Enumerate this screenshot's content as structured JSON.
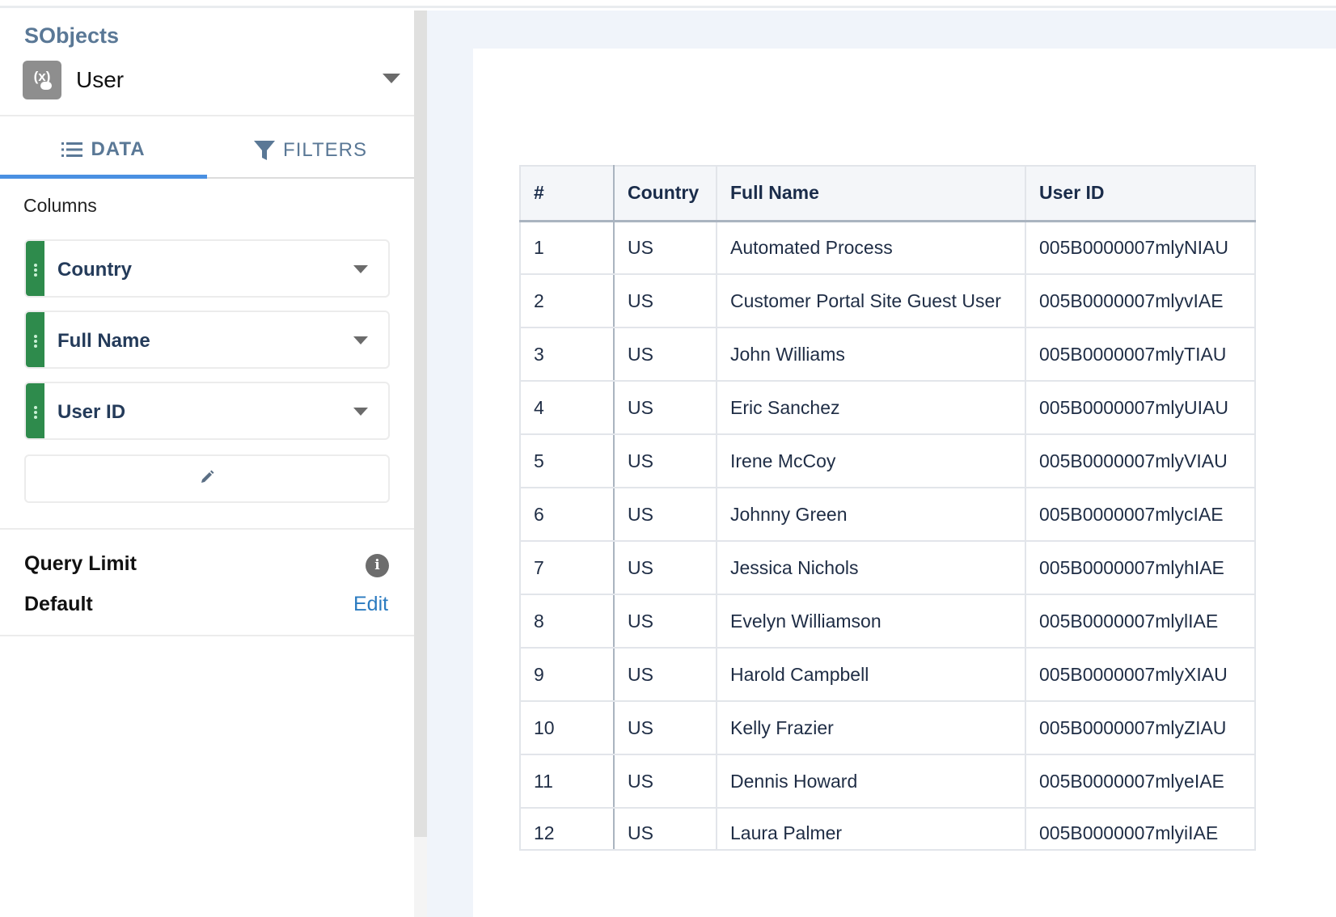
{
  "sidebar": {
    "section_title": "SObjects",
    "object": {
      "name": "User",
      "icon": "salesforce-variable-icon"
    },
    "tabs": [
      {
        "label": "DATA",
        "icon": "list-icon",
        "active": true
      },
      {
        "label": "FILTERS",
        "icon": "filter-icon",
        "active": false
      }
    ],
    "columns_label": "Columns",
    "columns": [
      {
        "label": "Country"
      },
      {
        "label": "Full Name"
      },
      {
        "label": "User ID"
      }
    ],
    "edit_columns_icon": "pencil-icon",
    "query_limit": {
      "label": "Query Limit",
      "value": "Default",
      "edit_label": "Edit",
      "info_icon": "info-icon"
    }
  },
  "colors": {
    "accent": "#4a90e2",
    "handle_green": "#2e8b4c",
    "link_blue": "#2b7bc0",
    "header_text": "#5a7896"
  },
  "table": {
    "headers": [
      "#",
      "Country",
      "Full Name",
      "User ID"
    ],
    "rows": [
      [
        "1",
        "US",
        "Automated Process",
        "005B0000007mlyNIAU"
      ],
      [
        "2",
        "US",
        "Customer Portal Site Guest User",
        "005B0000007mlyvIAE"
      ],
      [
        "3",
        "US",
        "John Williams",
        "005B0000007mlyTIAU"
      ],
      [
        "4",
        "US",
        "Eric Sanchez",
        "005B0000007mlyUIAU"
      ],
      [
        "5",
        "US",
        "Irene McCoy",
        "005B0000007mlyVIAU"
      ],
      [
        "6",
        "US",
        "Johnny Green",
        "005B0000007mlycIAE"
      ],
      [
        "7",
        "US",
        "Jessica Nichols",
        "005B0000007mlyhIAE"
      ],
      [
        "8",
        "US",
        "Evelyn Williamson",
        "005B0000007mlylIAE"
      ],
      [
        "9",
        "US",
        "Harold Campbell",
        "005B0000007mlyXIAU"
      ],
      [
        "10",
        "US",
        "Kelly Frazier",
        "005B0000007mlyZIAU"
      ],
      [
        "11",
        "US",
        "Dennis Howard",
        "005B0000007mlyeIAE"
      ],
      [
        "12",
        "US",
        "Laura Palmer",
        "005B0000007mlyiIAE"
      ]
    ]
  }
}
